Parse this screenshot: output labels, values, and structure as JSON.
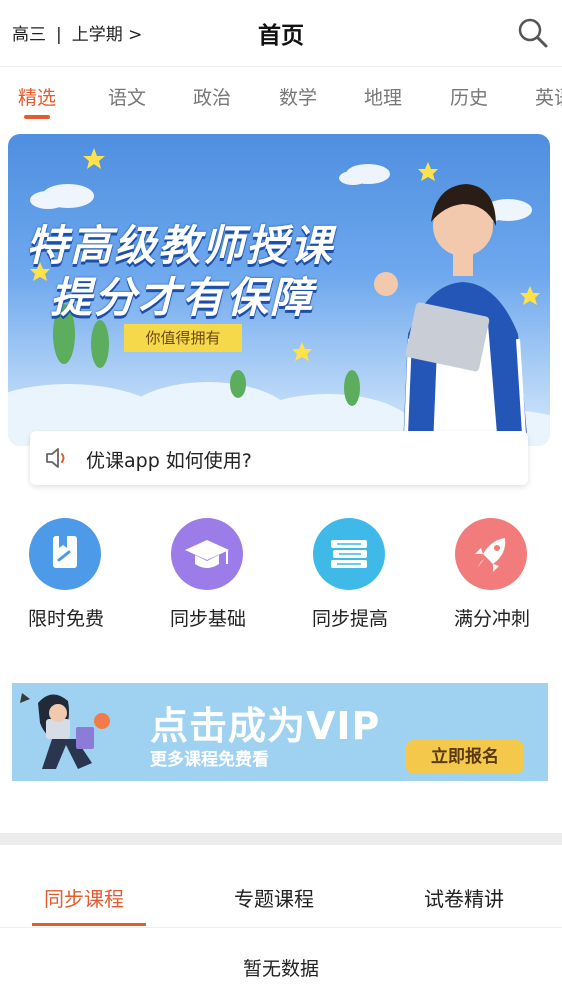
{
  "header": {
    "grade": "高三",
    "separator": "|",
    "term": "上学期",
    "chevron": ">",
    "title": "首页",
    "search_icon": "search-icon"
  },
  "tabs": [
    {
      "label": "精选",
      "active": true
    },
    {
      "label": "语文"
    },
    {
      "label": "政治"
    },
    {
      "label": "数学"
    },
    {
      "label": "地理"
    },
    {
      "label": "历史"
    },
    {
      "label": "英语"
    }
  ],
  "banner": {
    "line1": "特高级教师授课",
    "line2": "提分才有保障",
    "tag": "你值得拥有"
  },
  "notice": {
    "icon": "speaker-icon",
    "text": "优课app 如何使用?"
  },
  "quick_links": [
    {
      "label": "限时免费",
      "icon": "book-icon",
      "color": "#4d9be8"
    },
    {
      "label": "同步基础",
      "icon": "graduation-cap-icon",
      "color": "#9b7ce8"
    },
    {
      "label": "同步提高",
      "icon": "books-stack-icon",
      "color": "#3eb9e8"
    },
    {
      "label": "满分冲刺",
      "icon": "rocket-icon",
      "color": "#f27b7b"
    }
  ],
  "vip": {
    "title": "点击成为VIP",
    "subtitle": "更多课程免费看",
    "button": "立即报名"
  },
  "course_tabs": [
    {
      "label": "同步课程",
      "active": true
    },
    {
      "label": "专题课程"
    },
    {
      "label": "试卷精讲"
    }
  ],
  "empty_text": "暂无数据",
  "colors": {
    "accent": "#e35c2f"
  }
}
